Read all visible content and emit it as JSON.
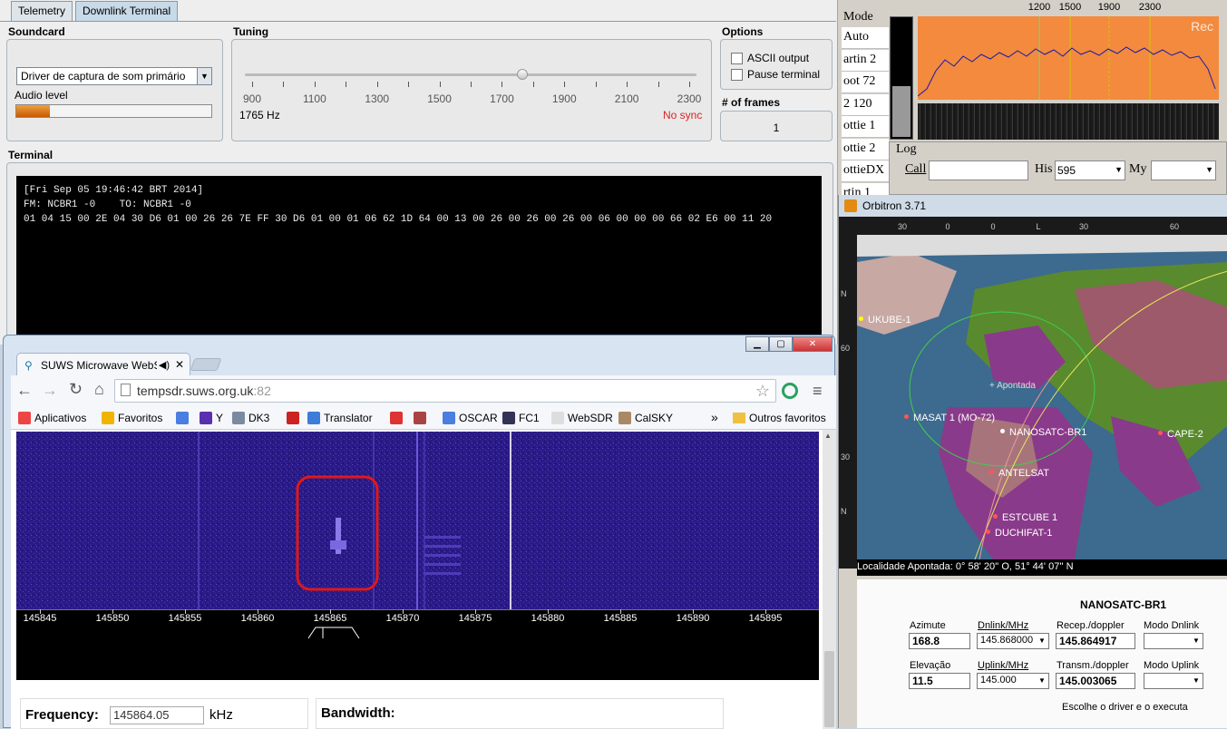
{
  "telemetry": {
    "tabs": [
      "Telemetry",
      "Downlink Terminal"
    ],
    "soundcard": {
      "title": "Soundcard",
      "device": "Driver de captura de som primário",
      "audio_level_label": "Audio level",
      "audio_level": 0.17
    },
    "tuning": {
      "title": "Tuning",
      "scale": [
        "900",
        "1100",
        "1300",
        "1500",
        "1700",
        "1900",
        "2100",
        "2300"
      ],
      "slider_value": 1765,
      "freq": "1765 Hz",
      "sync": "No sync"
    },
    "options": {
      "title": "Options",
      "ascii": "ASCII output",
      "pause": "Pause terminal",
      "frames_label": "# of frames",
      "frames": "1"
    },
    "terminal": {
      "title": "Terminal",
      "line1": "[Fri Sep 05 19:46:42 BRT 2014]",
      "line2": "FM: NCBR1 -0    TO: NCBR1 -0",
      "line3": "01 04 15 00 2E 04 30 D6 01 00 26 26 7E FF 30 D6 01 00 01 06 62 1D 64 00 13 00 26 00 26 00 26 00 06 00 00 00 66 02 E6 00 11 20"
    }
  },
  "sstv": {
    "mode_label": "Mode",
    "modes": [
      "Auto",
      "artin 2",
      "oot 72",
      "2 120",
      "ottie 1",
      "ottie 2",
      "ottieDX",
      "rtin 1"
    ],
    "freq_marks": [
      "1200",
      "1500",
      "1900",
      "2300"
    ],
    "rec": "Rec",
    "log": {
      "title": "Log",
      "call": "Call",
      "his": "His",
      "his_value": "595",
      "my": "My"
    }
  },
  "orbitron": {
    "title": "Orbitron 3.71",
    "map": {
      "top_ticks": [
        "30",
        "0",
        "0",
        "L",
        "30",
        "60"
      ],
      "left_ticks": [
        "N",
        "60",
        "30",
        "N"
      ],
      "satellites": [
        "UKUBE-1",
        "MASAT 1 (MO-72)",
        "NANOSATC-BR1",
        "CAPE-2",
        "ANTELSAT",
        "ESTCUBE 1",
        "DUCHIFAT-1"
      ],
      "pointed_label": "Apontada",
      "location": "Localidade Apontada: 0° 58' 20'' O, 51° 44' 07'' N"
    },
    "panel": {
      "sat_name": "NANOSATC-BR1",
      "azimuth_label": "Azimute",
      "azimuth": "168.8",
      "dnlink_label": "Dnlink/MHz",
      "dnlink": "145.868000",
      "recep_label": "Recep./doppler",
      "recep": "145.864917",
      "modo_dn_label": "Modo Dnlink",
      "elev_label": "Elevação",
      "elev": "11.5",
      "uplink_label": "Uplink/MHz",
      "uplink": "145.000",
      "transm_label": "Transm./doppler",
      "transm": "145.003065",
      "modo_up_label": "Modo Uplink",
      "footer": "Escolhe o driver e o executa"
    }
  },
  "chrome": {
    "tab_title": "SUWS Microwave WebS",
    "url_host": "tempsdr.suws.org.uk",
    "url_port": ":82",
    "bookmarks": [
      "Aplicativos",
      "Favoritos",
      "",
      "Y",
      "DK3",
      "",
      "Translator",
      "",
      "",
      "OSCAR",
      "FC1",
      "WebSDR",
      "CalSKY"
    ],
    "more": "»",
    "other_bookmarks": "Outros favoritos",
    "freq_scale": [
      "145845",
      "145850",
      "145855",
      "145860",
      "145865",
      "145870",
      "145875",
      "145880",
      "145885",
      "145890",
      "145895"
    ],
    "frequency_label": "Frequency:",
    "frequency_value": "145864.05",
    "frequency_unit": "kHz",
    "bandwidth_label": "Bandwidth:"
  }
}
